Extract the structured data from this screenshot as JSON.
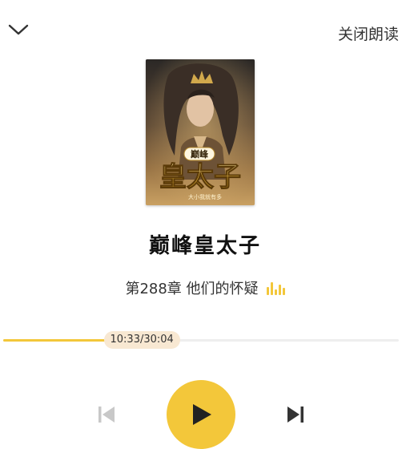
{
  "header": {
    "collapse_icon": "chevron-down-icon",
    "close_label": "关闭朗读"
  },
  "book": {
    "title": "巅峰皇太子",
    "cover": {
      "title_text": "巅峰皇太子",
      "author_text": "大小我就有多"
    },
    "chapter": "第288章  他们的怀疑",
    "status_icon": "equalizer-icon"
  },
  "player": {
    "time": "10:33/30:04",
    "progress": 0.351,
    "prev_icon": "skip-previous-icon",
    "play_icon": "play-icon",
    "next_icon": "skip-next-icon",
    "prev_enabled": false
  },
  "colors": {
    "accent": "#f3c73a",
    "badge_bg": "#f8e8d2",
    "disabled": "#c8c8c8",
    "icon": "#333333"
  }
}
